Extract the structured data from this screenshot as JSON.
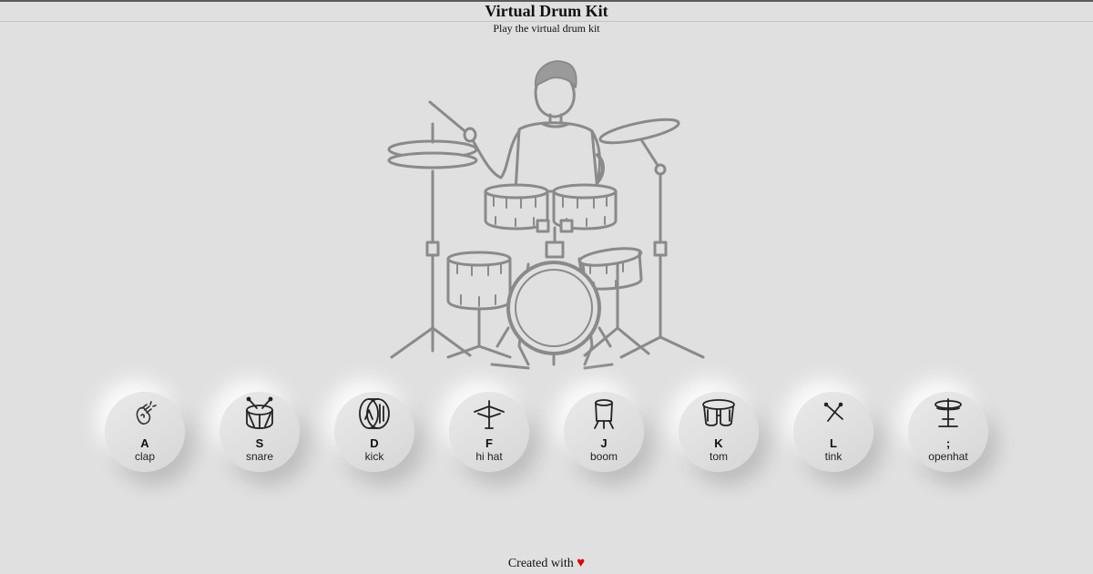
{
  "header": {
    "title": "Virtual Drum Kit",
    "subtitle": "Play the virtual drum kit"
  },
  "illustration": {
    "icon": "drummer-illustration",
    "stroke_color": "#8a8a8a"
  },
  "keys": [
    {
      "letter": "A",
      "sound": "clap",
      "icon": "clap-icon"
    },
    {
      "letter": "S",
      "sound": "snare",
      "icon": "snare-drum-icon"
    },
    {
      "letter": "D",
      "sound": "kick",
      "icon": "kick-drum-icon"
    },
    {
      "letter": "F",
      "sound": "hi hat",
      "icon": "hi-hat-icon"
    },
    {
      "letter": "J",
      "sound": "boom",
      "icon": "boom-drum-icon"
    },
    {
      "letter": "K",
      "sound": "tom",
      "icon": "bongo-icon"
    },
    {
      "letter": "L",
      "sound": "tink",
      "icon": "drumsticks-icon"
    },
    {
      "letter": ";",
      "sound": "openhat",
      "icon": "cymbal-icon"
    }
  ],
  "footer": {
    "text": "Created with",
    "heart": "♥",
    "heart_color": "#e00000"
  },
  "colors": {
    "background": "#e0e0e0",
    "topbar": "#5a5a5a"
  }
}
